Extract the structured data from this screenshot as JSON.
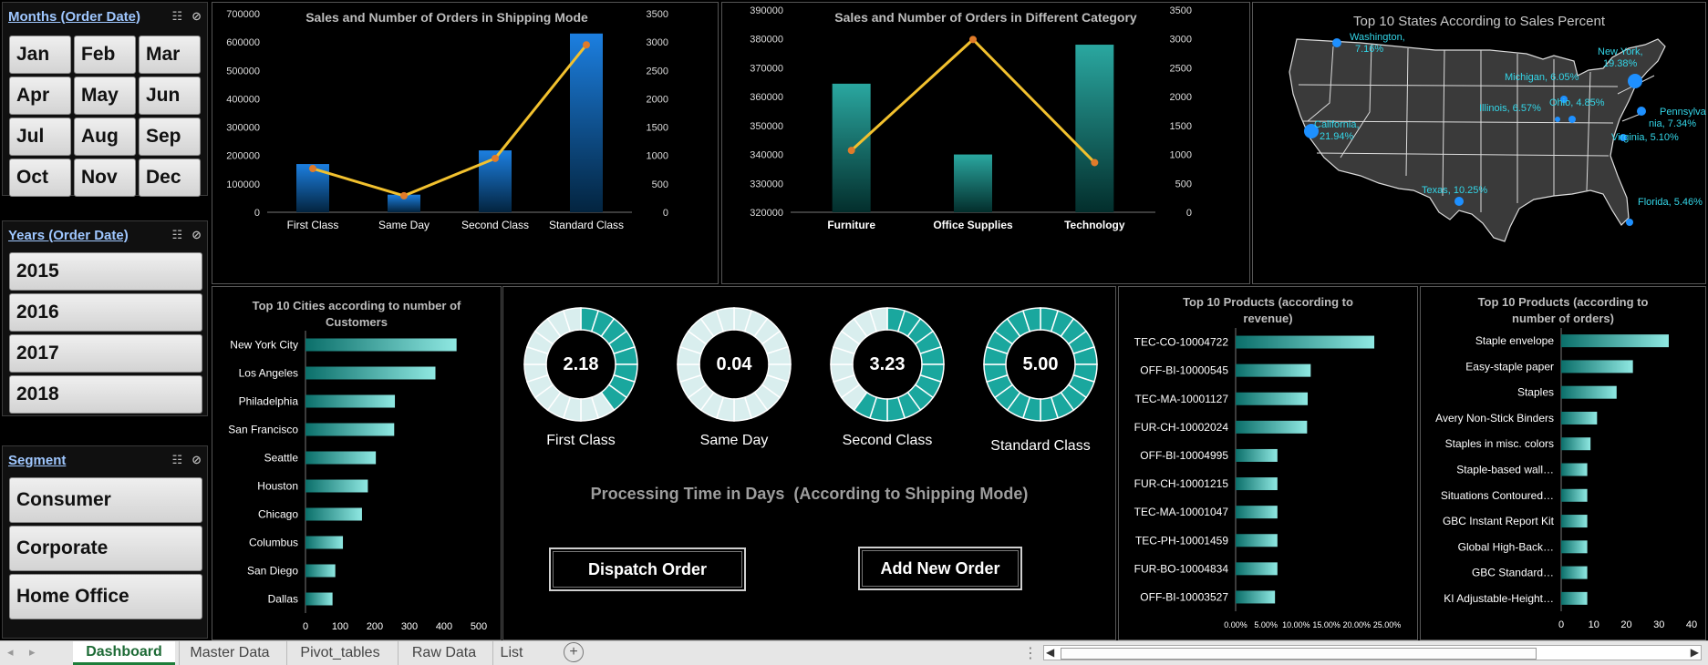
{
  "slicers": {
    "months": {
      "title": "Months (Order Date)",
      "items": [
        "Jan",
        "Feb",
        "Mar",
        "Apr",
        "May",
        "Jun",
        "Jul",
        "Aug",
        "Sep",
        "Oct",
        "Nov",
        "Dec"
      ]
    },
    "years": {
      "title": "Years (Order Date)",
      "items": [
        "2015",
        "2016",
        "2017",
        "2018"
      ]
    },
    "segment": {
      "title": "Segment",
      "items": [
        "Consumer",
        "Corporate",
        "Home Office"
      ]
    }
  },
  "chart_data": [
    {
      "id": "shipping",
      "type": "bar",
      "title": "Sales and Number of Orders in Shipping Mode",
      "categories": [
        "First Class",
        "Same Day",
        "Second Class",
        "Standard Class"
      ],
      "series": [
        {
          "values": [
            170000,
            62000,
            218000,
            630000
          ]
        },
        {
          "values": [
            770,
            290,
            950,
            2950
          ]
        }
      ],
      "ylim": [
        0,
        700000
      ],
      "y_ticks": [
        "700000",
        "600000",
        "500000",
        "400000",
        "300000",
        "200000",
        "100000",
        "0"
      ],
      "y2lim": [
        0,
        3500
      ],
      "y2_ticks": [
        "3500",
        "3000",
        "2500",
        "2000",
        "1500",
        "1000",
        "500",
        "0"
      ]
    },
    {
      "id": "category",
      "type": "bar",
      "title": "Sales and Number of Orders in Different Category",
      "categories": [
        "Furniture",
        "Office Supplies",
        "Technology"
      ],
      "series": [
        {
          "values": [
            364500,
            340000,
            378000
          ]
        },
        {
          "values": [
            1070,
            2990,
            860
          ]
        }
      ],
      "ylim": [
        320000,
        390000
      ],
      "y_ticks": [
        "390000",
        "380000",
        "370000",
        "360000",
        "350000",
        "340000",
        "330000",
        "320000"
      ],
      "y2lim": [
        0,
        3500
      ],
      "y2_ticks": [
        "3500",
        "3000",
        "2500",
        "2000",
        "1500",
        "1000",
        "500",
        "0"
      ]
    },
    {
      "id": "cities",
      "type": "bar",
      "title": "Top 10 Cities according to number of Customers",
      "categories": [
        "New York City",
        "Los Angeles",
        "Philadelphia",
        "San Francisco",
        "Seattle",
        "Houston",
        "Chicago",
        "Columbus",
        "San Diego",
        "Dallas"
      ],
      "values": [
        436,
        375,
        258,
        256,
        203,
        180,
        163,
        108,
        86,
        78
      ],
      "xlim": [
        0,
        500
      ],
      "x_ticks": [
        "0",
        "100",
        "200",
        "300",
        "400",
        "500"
      ]
    },
    {
      "id": "products_revenue",
      "type": "bar",
      "title": "Top 10 Products (according to revenue)",
      "categories": [
        "TEC-CO-10004722",
        "OFF-BI-10000545",
        "TEC-MA-10001127",
        "FUR-CH-10002024",
        "OFF-BI-10004995",
        "FUR-CH-10001215",
        "TEC-MA-10001047",
        "TEC-PH-10001459",
        "FUR-BO-10004834",
        "OFF-BI-10003527"
      ],
      "values": [
        22.9,
        12.4,
        11.9,
        11.8,
        6.9,
        6.9,
        6.9,
        6.9,
        6.9,
        6.5
      ],
      "xlim": [
        0,
        25
      ],
      "x_ticks": [
        "0.00%",
        "5.00%",
        "10.00%",
        "15.00%",
        "20.00%",
        "25.00%"
      ]
    },
    {
      "id": "products_orders",
      "type": "bar",
      "title": "Top 10 Products (according to number of orders)",
      "categories": [
        "Staple envelope",
        "Easy-staple paper",
        "Staples",
        "Avery Non-Stick Binders",
        "Staples in misc. colors",
        "Staple-based wall…",
        "Situations Contoured…",
        "GBC Instant Report Kit",
        "Global High-Back…",
        "GBC Standard…",
        "KI Adjustable-Height…"
      ],
      "values": [
        33,
        22,
        17,
        11,
        9,
        8,
        8,
        8,
        8,
        8,
        8
      ],
      "xlim": [
        0,
        40
      ],
      "x_ticks": [
        "0",
        "10",
        "20",
        "30",
        "40"
      ]
    }
  ],
  "map": {
    "title": "Top 10 States According  to Sales Percent",
    "labels": [
      {
        "state": "Washington,",
        "value": "7.16%"
      },
      {
        "state": "New York,",
        "value": "19.38%"
      },
      {
        "state": "Michigan,",
        "value": "6.05%"
      },
      {
        "state": "Ohio,",
        "value": "4.85%"
      },
      {
        "state": "Illinois,",
        "value": "6.57%"
      },
      {
        "state": "Pennsylva nia,",
        "value": "7.34%"
      },
      {
        "state": "California,",
        "value": "21.94%"
      },
      {
        "state": "Virginia,",
        "value": "5.10%"
      },
      {
        "state": "Texas,",
        "value": "10.25%"
      },
      {
        "state": "Florida,",
        "value": "5.46%"
      }
    ]
  },
  "processing": {
    "title": "Processing Time in Days  (According to Shipping Mode)",
    "gauges": [
      {
        "label": "First Class",
        "value": "2.18",
        "fraction": 0.436
      },
      {
        "label": "Same Day",
        "value": "0.04",
        "fraction": 0.01
      },
      {
        "label": "Second Class",
        "value": "3.23",
        "fraction": 0.646
      },
      {
        "label": "Standard Class",
        "value": "5.00",
        "fraction": 1.0
      }
    ],
    "buttons": {
      "dispatch": "Dispatch Order",
      "add": "Add New Order"
    }
  },
  "sheet_tabs": [
    "Dashboard",
    "Master Data",
    "Pivot_tables",
    "Raw Data",
    "List"
  ],
  "colors": {
    "teal": "#2bb6ad",
    "blue": "#2a8fe0",
    "line": "#f2c12e",
    "map_dot": "#1e90ff",
    "map_label": "#33d6e8"
  }
}
